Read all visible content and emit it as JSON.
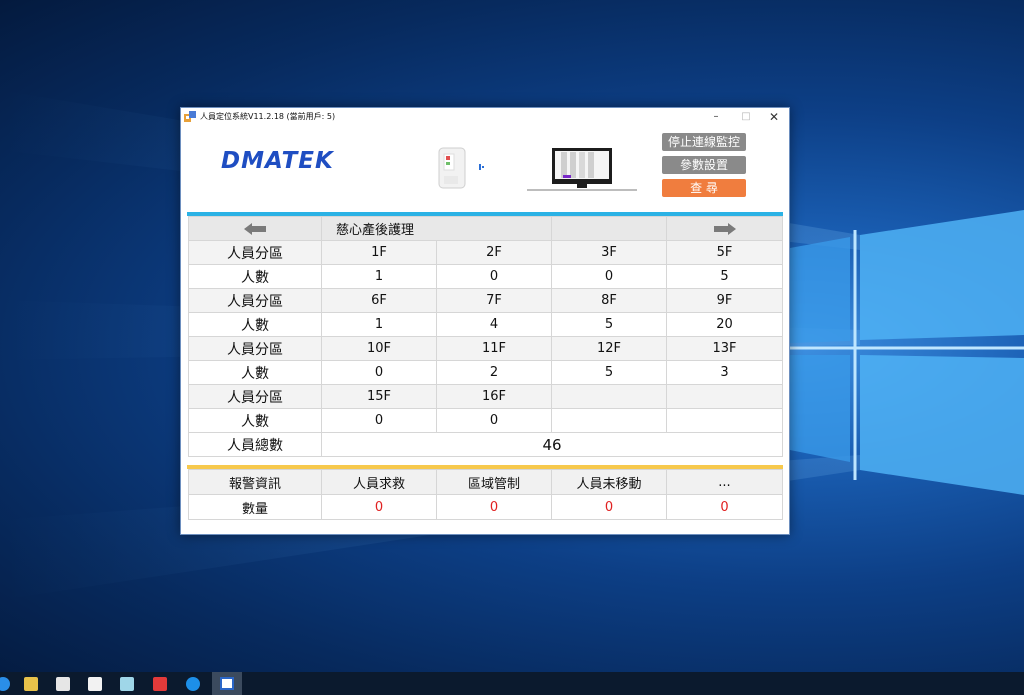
{
  "window": {
    "title": "人員定位系統V11.2.18 (當前用戶: 5)",
    "minimize": "–",
    "maximize": "□",
    "close": "✕"
  },
  "brand": {
    "logo": "DMATEK"
  },
  "buttons": {
    "stop_monitor": "停止連線監控",
    "settings": "參數設置",
    "query": "查 尋"
  },
  "header": {
    "group_title": "慈心產後護理"
  },
  "labels": {
    "zone": "人員分區",
    "count": "人數",
    "total": "人員總數"
  },
  "zones": [
    [
      {
        "floor": "1F",
        "count": "1"
      },
      {
        "floor": "2F",
        "count": "0"
      },
      {
        "floor": "3F",
        "count": "0"
      },
      {
        "floor": "5F",
        "count": "5"
      }
    ],
    [
      {
        "floor": "6F",
        "count": "1"
      },
      {
        "floor": "7F",
        "count": "4"
      },
      {
        "floor": "8F",
        "count": "5"
      },
      {
        "floor": "9F",
        "count": "20"
      }
    ],
    [
      {
        "floor": "10F",
        "count": "0"
      },
      {
        "floor": "11F",
        "count": "2"
      },
      {
        "floor": "12F",
        "count": "5"
      },
      {
        "floor": "13F",
        "count": "3"
      }
    ],
    [
      {
        "floor": "15F",
        "count": "0"
      },
      {
        "floor": "16F",
        "count": "0"
      },
      {
        "floor": "",
        "count": ""
      },
      {
        "floor": "",
        "count": ""
      }
    ]
  ],
  "total_count": "46",
  "alarm": {
    "title": "報警資訊",
    "quantity_label": "數量",
    "columns": [
      "人員求救",
      "區域管制",
      "人員未移動",
      "..."
    ],
    "values": [
      "0",
      "0",
      "0",
      "0"
    ]
  },
  "colors": {
    "blue_bar": "#2bb2e5",
    "yellow_bar": "#f7c94d",
    "query_button": "#f07d3e",
    "alarm_value": "#e02020"
  }
}
